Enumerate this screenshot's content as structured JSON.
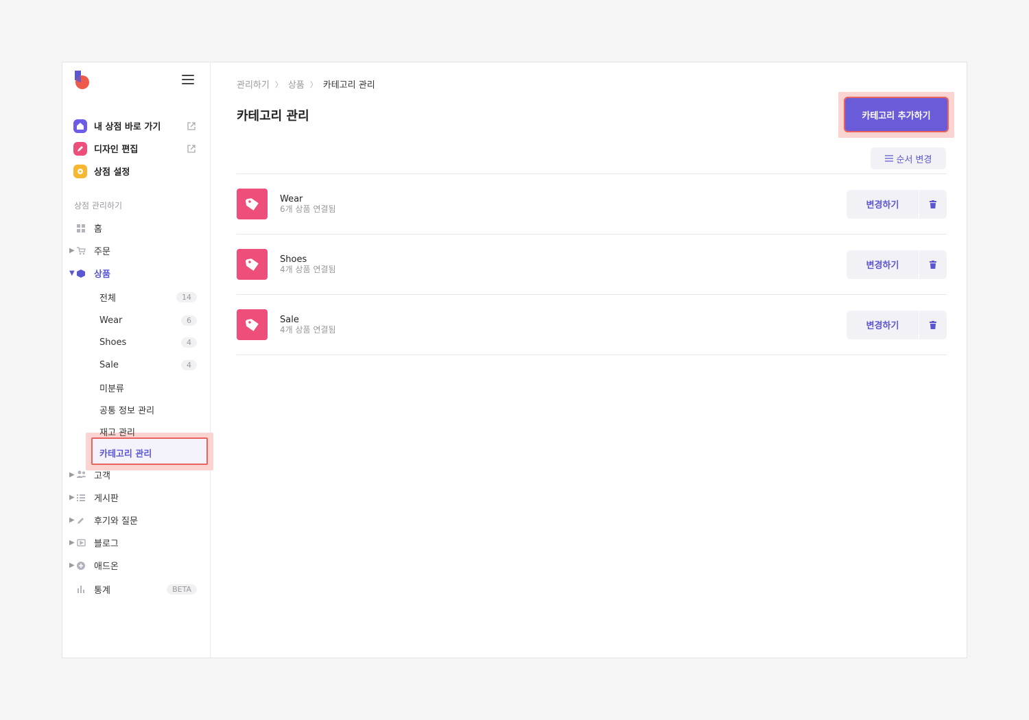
{
  "sidebar": {
    "quick_links": [
      {
        "label": "내 상점 바로 가기",
        "icon": "house-icon"
      },
      {
        "label": "디자인 편집",
        "icon": "pencil-icon"
      },
      {
        "label": "상점 설정",
        "icon": "gear-icon"
      }
    ],
    "section_title": "상점 관리하기",
    "nav": {
      "home": "홈",
      "orders": "주문",
      "products": "상품",
      "product_sub": {
        "all": {
          "label": "전체",
          "count": "14"
        },
        "wear": {
          "label": "Wear",
          "count": "6"
        },
        "shoes": {
          "label": "Shoes",
          "count": "4"
        },
        "sale": {
          "label": "Sale",
          "count": "4"
        },
        "uncategorized": "미분류",
        "common_info": "공통 정보 관리",
        "inventory": "재고 관리",
        "category": "카테고리 관리"
      },
      "customers": "고객",
      "board": "게시판",
      "reviews": "후기와 질문",
      "blog": "블로그",
      "addons": "애드온",
      "stats": "통계",
      "stats_badge": "BETA"
    }
  },
  "main": {
    "breadcrumb": [
      "관리하기",
      "상품",
      "카테고리 관리"
    ],
    "title": "카테고리 관리",
    "add_button": "카테고리 추가하기",
    "order_button": "순서 변경",
    "edit_label": "변경하기",
    "categories": [
      {
        "name": "Wear",
        "count_text": "6개 상품 연결됨"
      },
      {
        "name": "Shoes",
        "count_text": "4개 상품 연결됨"
      },
      {
        "name": "Sale",
        "count_text": "4개 상품 연결됨"
      }
    ]
  },
  "colors": {
    "accent": "#6a5cd8",
    "tag": "#ee4f7a",
    "highlight": "#e9625b"
  }
}
